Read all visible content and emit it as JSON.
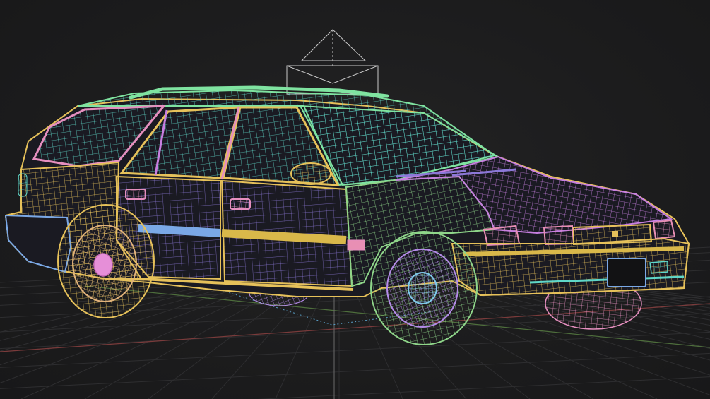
{
  "viewport": {
    "background": "#1c1c1d",
    "grid_color": "#2e2e30",
    "axis_x_color": "#7a3b3b",
    "axis_z_color": "#4e6e3c",
    "camera_gizmo_color": "#c8c8c8"
  },
  "model": {
    "display_mode": "wireframe",
    "object_colors": {
      "body_outline": "#e6c15a",
      "roof_rails": "#7fe3a0",
      "glass": "#5fd7c8",
      "hood": "#c77fe0",
      "doors": "#9a7fe6",
      "side_trim": "#7aa8e6",
      "front_bumper": "#d9b84a",
      "rear_quarter": "#e58fbf",
      "front_fender": "#8fd68a",
      "front_wheel": "#b48be8",
      "front_hub": "#7ec8e8",
      "rear_wheel": "#e0b27a",
      "rear_hub": "#e68fd8",
      "tires": "#8fe08a",
      "headlights": "#e88fb4"
    }
  }
}
